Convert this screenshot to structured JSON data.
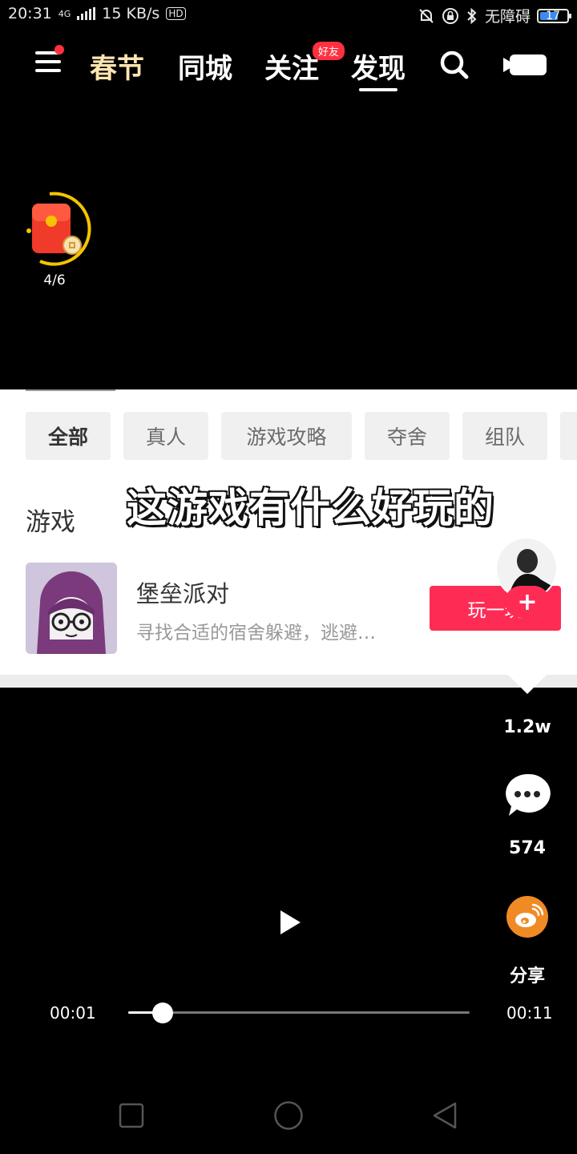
{
  "status_bar": {
    "time": "20:31",
    "network": "4G",
    "speed": "15 KB/s",
    "hd": "HD",
    "accessibility": "无障碍",
    "battery": "17"
  },
  "top_nav": {
    "tabs": [
      {
        "label": "春节"
      },
      {
        "label": "同城"
      },
      {
        "label": "关注",
        "badge": "好友"
      },
      {
        "label": "发现",
        "active": true
      }
    ]
  },
  "red_packet": {
    "progress": "4/6"
  },
  "card": {
    "chips": [
      "全部",
      "真人",
      "游戏攻略",
      "夺舍",
      "组队"
    ],
    "active_chip": "全部",
    "section_title": "游戏",
    "caption": "这游戏有什么好玩的",
    "game": {
      "title": "堡垒派对",
      "description": "寻找合适的宿舍躲避，逃避…",
      "button": "玩一玩"
    }
  },
  "actions": {
    "likes": "1.2w",
    "comments": "574",
    "share": "分享"
  },
  "player": {
    "current": "00:01",
    "total": "00:11",
    "progress": 0.1
  },
  "colors": {
    "accent": "#fe2c55",
    "share_orange": "#f08a24",
    "packet_ring": "#f5c400"
  }
}
